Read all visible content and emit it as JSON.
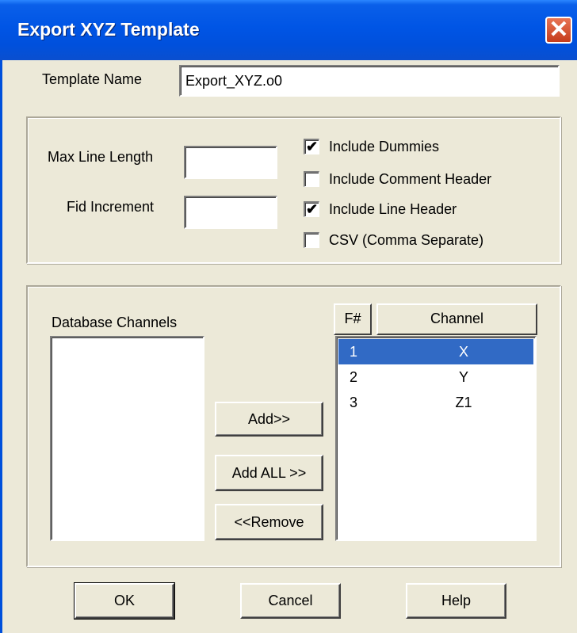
{
  "window": {
    "title": "Export XYZ Template",
    "close_glyph": "✕"
  },
  "template_name": {
    "label": "Template Name",
    "value": "Export_XYZ.o0"
  },
  "options": {
    "max_line_length": {
      "label": "Max Line Length",
      "value": ""
    },
    "fid_increment": {
      "label": "Fid Increment",
      "value": ""
    },
    "checkboxes": [
      {
        "label": "Include Dummies",
        "checked": true
      },
      {
        "label": "Include Comment Header",
        "checked": false
      },
      {
        "label": "Include Line Header",
        "checked": true
      },
      {
        "label": "CSV (Comma Separate)",
        "checked": false
      }
    ]
  },
  "channels": {
    "database_label": "Database Channels",
    "database_items": [],
    "add_label": "Add>>",
    "add_all_label": "Add ALL >>",
    "remove_label": "<<Remove",
    "columns": {
      "f": "F#",
      "channel": "Channel"
    },
    "rows": [
      {
        "f": "1",
        "channel": "X",
        "selected": true
      },
      {
        "f": "2",
        "channel": "Y",
        "selected": false
      },
      {
        "f": "3",
        "channel": "Z1",
        "selected": false
      }
    ]
  },
  "buttons": {
    "ok": "OK",
    "cancel": "Cancel",
    "help": "Help"
  },
  "colors": {
    "titlebar": "#0055e5",
    "dialog_bg": "#ece9d8",
    "selection": "#316ac5",
    "close": "#c53c1c"
  },
  "icons": {
    "close": "close-icon",
    "check": "checkmark-icon"
  }
}
